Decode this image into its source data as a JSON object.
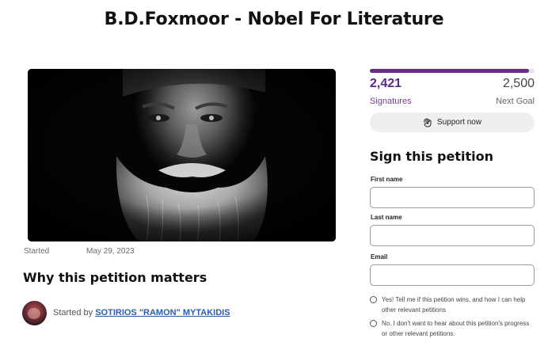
{
  "page": {
    "title": "B.D.Foxmoor - Nobel For Literature"
  },
  "petition": {
    "started_label": "Started",
    "started_date": "May 29, 2023",
    "why_heading": "Why this petition matters",
    "starter_prefix": "Started by",
    "starter_name": "SOTIRIOS \"RAMON\" MYTAKIDIS"
  },
  "progress": {
    "signatures": "2,421",
    "signatures_label": "Signatures",
    "goal": "2,500",
    "goal_label": "Next Goal",
    "fraction": 0.968,
    "color": "#6b2a8a"
  },
  "support": {
    "label": "Support now",
    "icon": "hand-heart-icon"
  },
  "form": {
    "heading": "Sign this petition",
    "first_name_label": "First name",
    "first_name_value": "",
    "last_name_label": "Last name",
    "last_name_value": "",
    "email_label": "Email",
    "email_value": "",
    "option_yes": "Yes! Tell me if this petition wins, and how I can help other relevant petitions",
    "option_no": "No. I don't want to hear about this petition's progress or other relevant petitions."
  }
}
